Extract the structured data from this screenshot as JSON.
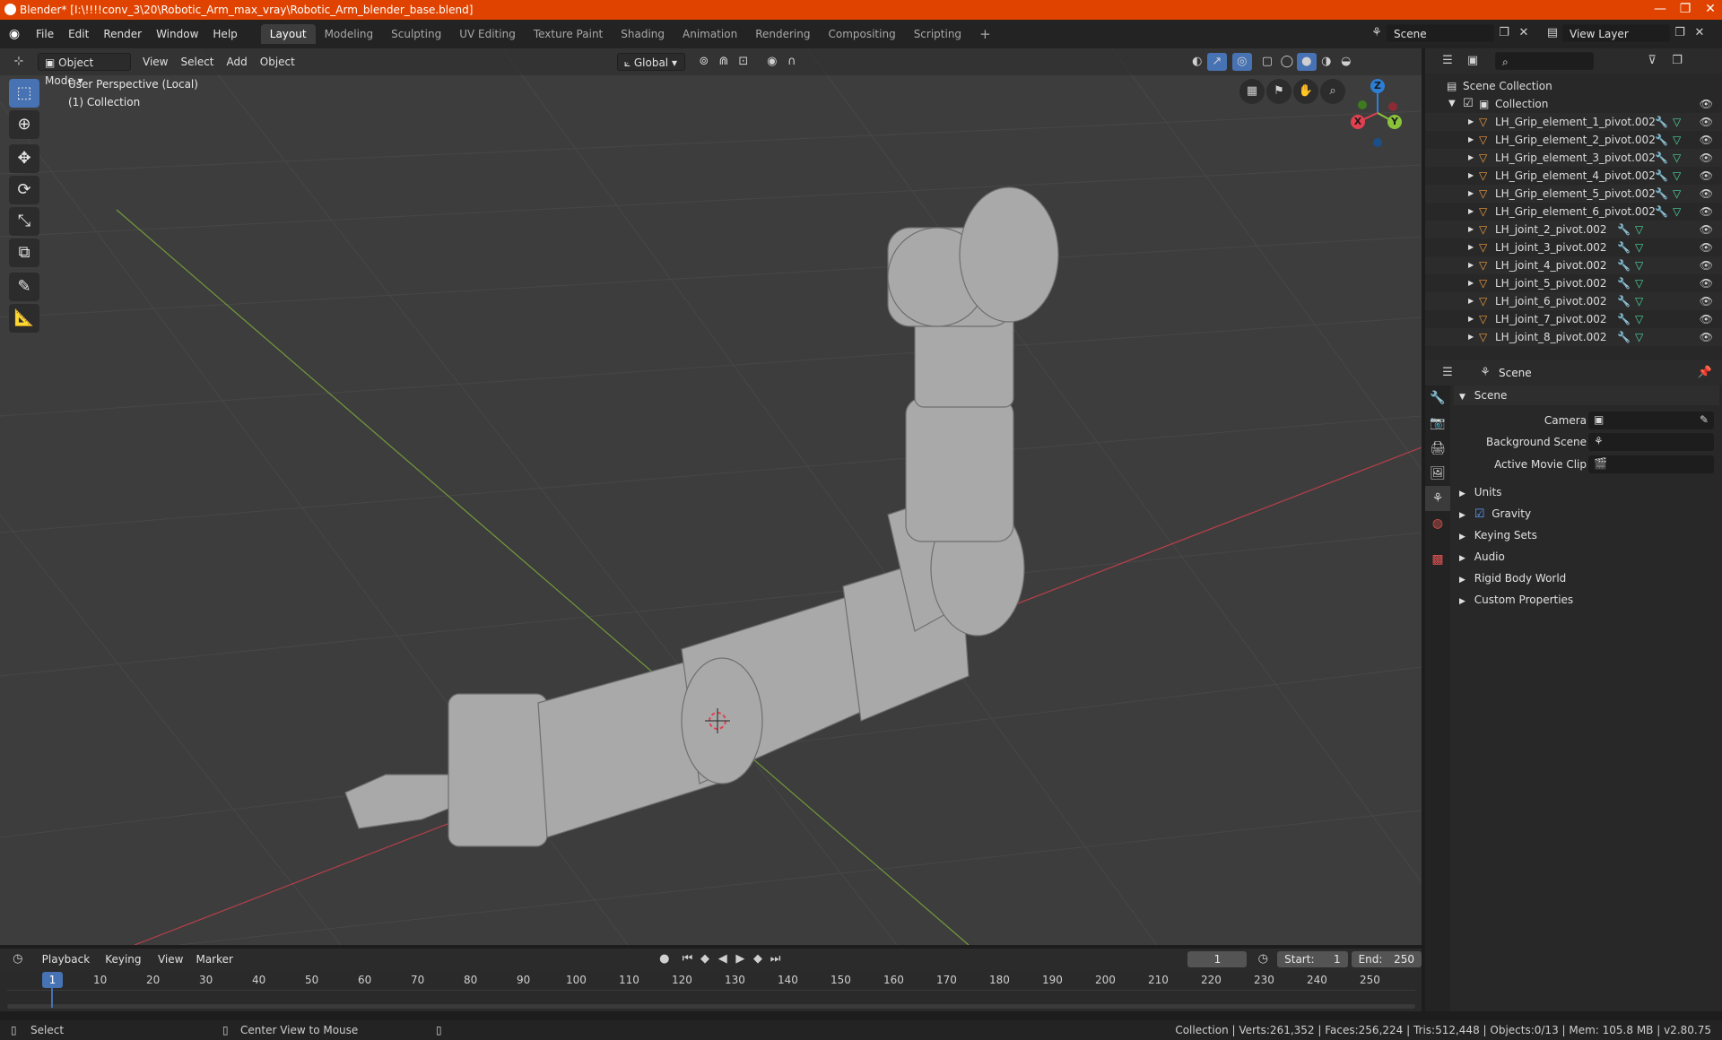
{
  "window": {
    "title": "Blender* [I:\\!!!!conv_3\\20\\Robotic_Arm_max_vray\\Robotic_Arm_blender_base.blend]",
    "min_glyph": "—",
    "max_glyph": "❐",
    "close_glyph": "✕"
  },
  "menubar": {
    "menus": [
      "File",
      "Edit",
      "Render",
      "Window",
      "Help"
    ],
    "workspaces": [
      "Layout",
      "Modeling",
      "Sculpting",
      "UV Editing",
      "Texture Paint",
      "Shading",
      "Animation",
      "Rendering",
      "Compositing",
      "Scripting"
    ],
    "active_workspace": "Layout",
    "add_workspace": "+",
    "scene_name": "Scene",
    "view_layer": "View Layer"
  },
  "viewport": {
    "mode": "Object Mode",
    "menus": [
      "View",
      "Select",
      "Add",
      "Object"
    ],
    "orientation": "Global",
    "info_line1": "User Perspective (Local)",
    "info_line2": "(1) Collection",
    "gizmo": {
      "x": "X",
      "y": "Y",
      "z": "Z"
    },
    "colors": {
      "x_axis": "#e0404f",
      "y_axis": "#8ac33a",
      "z_axis": "#2d7fd6",
      "grid": "#474747",
      "model": "#a9a9a9"
    }
  },
  "toolbar": {
    "tools": [
      "select-box",
      "cursor",
      "move",
      "rotate",
      "scale",
      "transform",
      "annotate",
      "measure"
    ]
  },
  "outliner": {
    "root": "Scene Collection",
    "collection": "Collection",
    "items": [
      "LH_Grip_element_1_pivot.002",
      "LH_Grip_element_2_pivot.002",
      "LH_Grip_element_3_pivot.002",
      "LH_Grip_element_4_pivot.002",
      "LH_Grip_element_5_pivot.002",
      "LH_Grip_element_6_pivot.002",
      "LH_joint_2_pivot.002",
      "LH_joint_3_pivot.002",
      "LH_joint_4_pivot.002",
      "LH_joint_5_pivot.002",
      "LH_joint_6_pivot.002",
      "LH_joint_7_pivot.002",
      "LH_joint_8_pivot.002"
    ]
  },
  "properties": {
    "header": "Scene",
    "panel": "Scene",
    "camera_label": "Camera",
    "background_scene_label": "Background Scene",
    "active_movie_clip_label": "Active Movie Clip",
    "subpanels": [
      "Units",
      "Gravity",
      "Keying Sets",
      "Audio",
      "Rigid Body World",
      "Custom Properties"
    ]
  },
  "timeline": {
    "menus": [
      "Playback",
      "Keying",
      "View",
      "Marker"
    ],
    "current_frame": "1",
    "start_label": "Start:",
    "start": "1",
    "end_label": "End:",
    "end": "250",
    "ticks": [
      "1",
      "10",
      "20",
      "30",
      "40",
      "50",
      "60",
      "70",
      "80",
      "90",
      "100",
      "110",
      "120",
      "130",
      "140",
      "150",
      "160",
      "170",
      "180",
      "190",
      "200",
      "210",
      "220",
      "230",
      "240",
      "250"
    ]
  },
  "statusbar": {
    "left": "Select",
    "middle": "Center View to Mouse",
    "right": "Collection | Verts:261,352 | Faces:256,224 | Tris:512,448 | Objects:0/13 | Mem: 105.8 MB | v2.80.75"
  }
}
